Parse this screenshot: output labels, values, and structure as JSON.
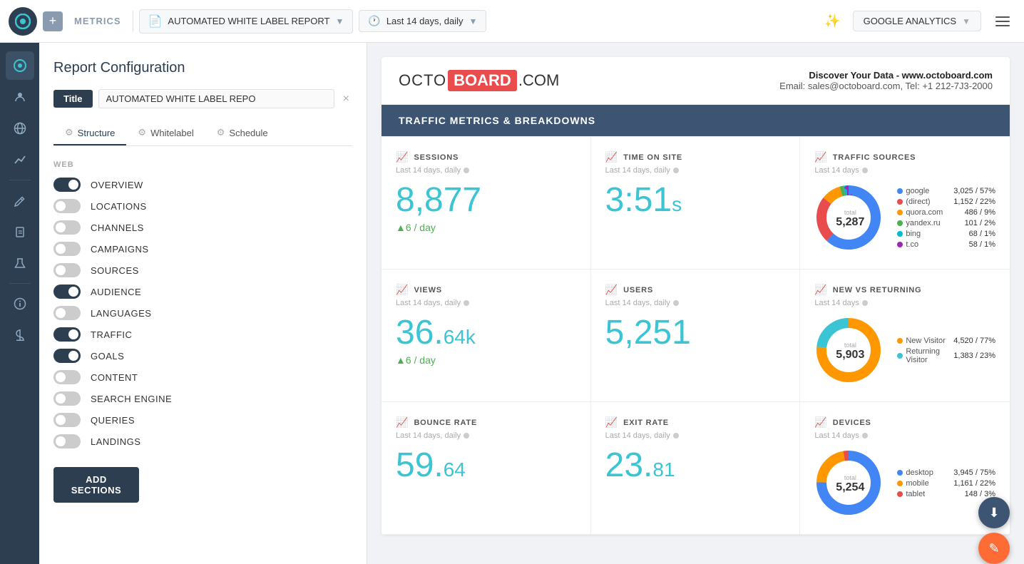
{
  "topnav": {
    "add_label": "+",
    "metrics_label": "METRICS",
    "report_name": "AUTOMATED WHITE LABEL REPORT",
    "date_range": "Last 14 days, daily",
    "ga_label": "GOOGLE ANALYTICS"
  },
  "config": {
    "title": "Report Configuration",
    "title_badge": "Title",
    "title_input_value": "AUTOMATED WHITE LABEL REPO",
    "tabs": [
      {
        "label": "Structure",
        "icon": "⚙"
      },
      {
        "label": "Whitelabel",
        "icon": "⚙"
      },
      {
        "label": "Schedule",
        "icon": "⚙"
      }
    ],
    "section_web": "WEB",
    "items": [
      {
        "label": "OVERVIEW",
        "checked": true
      },
      {
        "label": "LOCATIONS",
        "checked": false
      },
      {
        "label": "CHANNELS",
        "checked": false
      },
      {
        "label": "CAMPAIGNS",
        "checked": false
      },
      {
        "label": "SOURCES",
        "checked": false
      },
      {
        "label": "AUDIENCE",
        "checked": true
      },
      {
        "label": "LANGUAGES",
        "checked": false
      },
      {
        "label": "TRAFFIC",
        "checked": true
      },
      {
        "label": "GOALS",
        "checked": true
      },
      {
        "label": "CONTENT",
        "checked": false
      },
      {
        "label": "SEARCH ENGINE",
        "checked": false
      },
      {
        "label": "QUERIES",
        "checked": false
      },
      {
        "label": "LANDINGS",
        "checked": false
      }
    ],
    "add_sections_label": "ADD SECTIONS"
  },
  "report": {
    "logo_octo": "OCTO",
    "logo_board": "BOARD",
    "logo_com": ".COM",
    "tagline": "Discover Your Data - www.octoboard.com",
    "email_label": "Email:",
    "email": "sales@octoboard.com",
    "tel_label": "Tel:",
    "tel": "+1 212-7J3-2000",
    "section_header": "TRAFFIC METRICS & BREAKDOWNS",
    "metrics": [
      {
        "name": "SESSIONS",
        "period": "Last 14 days, daily",
        "value": "8,877",
        "subvalue": "▲6 / day",
        "type": "number"
      },
      {
        "name": "TIME ON SITE",
        "period": "Last 14 days, daily",
        "value": "3:51",
        "suffix": "s",
        "type": "time"
      },
      {
        "name": "TRAFFIC SOURCES",
        "period": "Last 14 days",
        "type": "donut",
        "total": "5,287",
        "items": [
          {
            "label": "google",
            "value": "3,025 / 57%",
            "color": "#4285f4"
          },
          {
            "label": "(direct)",
            "value": "1,152 / 22%",
            "color": "#e84c4c"
          },
          {
            "label": "quora.com",
            "value": "486  /  9%",
            "color": "#ff9800"
          },
          {
            "label": "yandex.ru",
            "value": "101  /  2%",
            "color": "#4caf50"
          },
          {
            "label": "bing",
            "value": "68  /  1%",
            "color": "#00bcd4"
          },
          {
            "label": "t.co",
            "value": "58  /  1%",
            "color": "#9c27b0"
          }
        ]
      },
      {
        "name": "VIEWS",
        "period": "Last 14 days, daily",
        "value": "36.",
        "value2": "64k",
        "subvalue": "▲6 / day",
        "type": "number2"
      },
      {
        "name": "USERS",
        "period": "Last 14 days, daily",
        "value": "5,251",
        "type": "number"
      },
      {
        "name": "NEW VS RETURNING",
        "period": "Last 14 days",
        "type": "donut",
        "total": "5,903",
        "items": [
          {
            "label": "New Visitor",
            "value": "4,520 / 77%",
            "color": "#ff9800"
          },
          {
            "label": "Returning Visitor",
            "value": "1,383 / 23%",
            "color": "#3bc4d4"
          }
        ]
      },
      {
        "name": "BOUNCE RATE",
        "period": "Last 14 days, daily",
        "value": "59.",
        "value2": "64",
        "type": "number2"
      },
      {
        "name": "EXIT RATE",
        "period": "Last 14 days, daily",
        "value": "23.",
        "value2": "81",
        "type": "number2"
      },
      {
        "name": "DEVICES",
        "period": "Last 14 days",
        "type": "donut",
        "total": "5,254",
        "items": [
          {
            "label": "desktop",
            "value": "3,945 / 75%",
            "color": "#4285f4"
          },
          {
            "label": "mobile",
            "value": "1,161 / 22%",
            "color": "#ff9800"
          },
          {
            "label": "tablet",
            "value": "148  /  3%",
            "color": "#e84c4c"
          }
        ]
      }
    ]
  },
  "icons": {
    "sidebar": [
      "chart-pie",
      "users",
      "globe",
      "git-branch",
      "pen",
      "clipboard",
      "flask",
      "info",
      "dollar"
    ],
    "fab_download": "⬇",
    "fab_edit": "✎"
  }
}
